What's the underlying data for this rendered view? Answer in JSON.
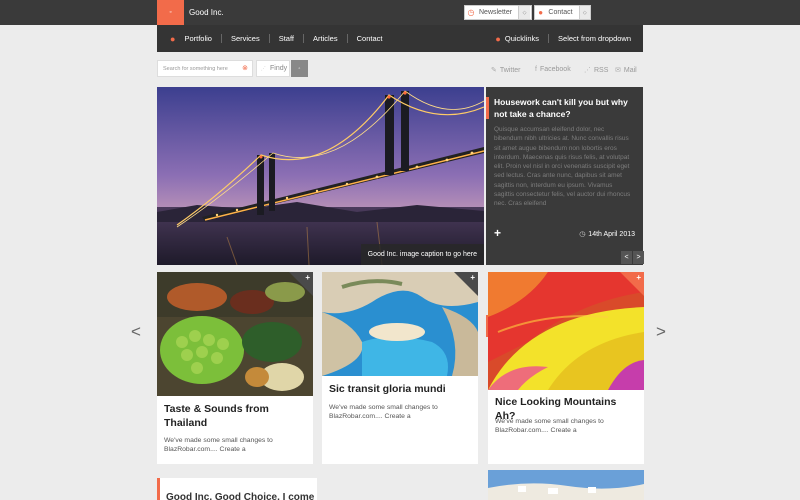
{
  "topbar": {
    "brand": "Good Inc.",
    "logo_glyph": "◦",
    "newsletter_label": "Newsletter",
    "contact_label": "Contact"
  },
  "nav": {
    "items": [
      "Portfolio",
      "Services",
      "Staff",
      "Articles",
      "Contact"
    ],
    "quicklinks": "Quicklinks",
    "dropdown": "Select from dropdown"
  },
  "search": {
    "placeholder": "Search for something here",
    "findy": "Findy",
    "go": "◦"
  },
  "social": {
    "twitter": "Twitter",
    "facebook": "Facebook",
    "rss": "RSS",
    "mail": "Mail"
  },
  "hero": {
    "caption": "Good Inc. image caption to go here"
  },
  "feature": {
    "title": "Housework can't kill you but why not take a chance?",
    "body": "Quisque accumsan eleifend dolor, nec bibendum nibh ultricies at. Nunc convallis risus sit amet augue bibendum non lobortis eros interdum. Maecenas quis risus felis, at volutpat elit. Proin vel nisl in orci venenatis suscipit eget sed lectus. Cras ante nunc, dapibus sit amet sagittis non, interdum eu ipsum. Vivamus sagittis consectetur felis, vel auctor dui rhoncus nec. Cras eleifend",
    "plus": "+",
    "date": "14th April 2013",
    "prev": "<",
    "next": ">"
  },
  "cards": [
    {
      "title": "Taste & Sounds from Thailand",
      "body": "We've made some small changes to BlazRobar.com.... Create a",
      "plus": "+"
    },
    {
      "title": "Sic transit gloria mundi",
      "body": "We've made some small changes to BlazRobar.com.... Create a",
      "plus": "+"
    },
    {
      "title": "Nice Looking Mountains Ah?",
      "body": "We've made some small changes to BlazRobar.com.... Create a",
      "plus": "+"
    }
  ],
  "carousel": {
    "prev": "<",
    "next": ">"
  },
  "bottom": {
    "title": "Good Inc. Good Choice. I come alive",
    "card4_plus": "+"
  },
  "colors": {
    "accent": "#f26b4a",
    "dark": "#3a3a3a"
  }
}
